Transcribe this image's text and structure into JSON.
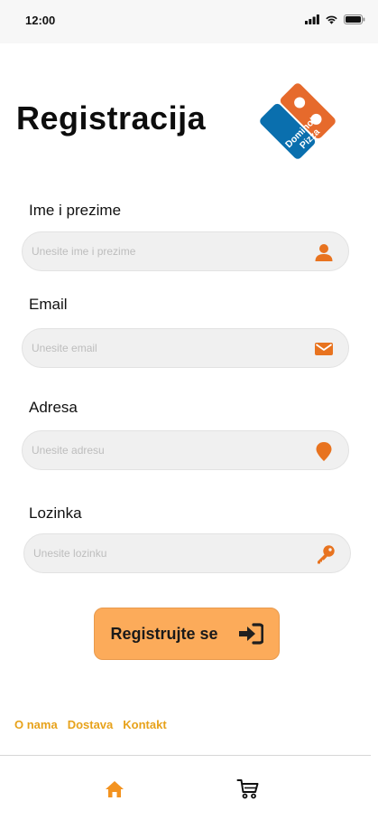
{
  "status_bar": {
    "time": "12:00"
  },
  "header": {
    "title": "Registracija",
    "logo": {
      "line1": "Domino's",
      "line2": "Pizza",
      "blue": "#0a6fae",
      "orange": "#e66a2c"
    }
  },
  "form": {
    "fields": [
      {
        "label": "Ime i prezime",
        "placeholder": "Unesite ime i prezime",
        "value": "",
        "icon": "user-icon"
      },
      {
        "label": "Email",
        "placeholder": "Unesite email",
        "value": "",
        "icon": "envelope-icon"
      },
      {
        "label": "Adresa",
        "placeholder": "Unesite adresu",
        "value": "",
        "icon": "map-pin-icon"
      },
      {
        "label": "Lozinka",
        "placeholder": "Unesite lozinku",
        "value": "",
        "icon": "key-icon"
      }
    ],
    "submit_label": "Registrujte se",
    "submit_icon": "sign-in-icon"
  },
  "footer": {
    "links": [
      "O nama",
      "Dostava",
      "Kontakt"
    ]
  },
  "bottom_nav": {
    "items": [
      "home-icon",
      "cart-icon"
    ]
  },
  "colors": {
    "accent": "#e8731f",
    "button_bg": "#fcab5a",
    "link": "#e7a21b",
    "field_bg": "#f0f0f0"
  }
}
